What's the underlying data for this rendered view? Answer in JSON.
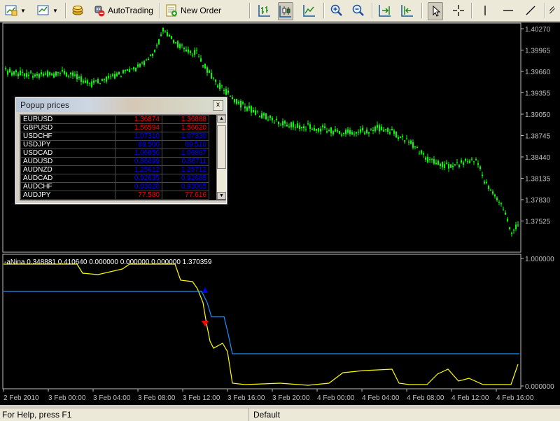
{
  "toolbar": {
    "autotrading_label": "AutoTrading",
    "new_order_label": "New Order"
  },
  "chart": {
    "price_ticks": [
      "1.40270",
      "1.39965",
      "1.39660",
      "1.39355",
      "1.39050",
      "1.38745",
      "1.38440",
      "1.38135",
      "1.37830",
      "1.37525"
    ],
    "indicator_label": "-aNina 0.348881 0.410640 0.000000 0.000000 0.000000 1.370359",
    "indicator_ticks": [
      "1.000000",
      "0.000000"
    ],
    "time_ticks": [
      "2 Feb 2010",
      "3 Feb 00:00",
      "3 Feb 04:00",
      "3 Feb 08:00",
      "3 Feb 12:00",
      "3 Feb 16:00",
      "3 Feb 20:00",
      "4 Feb 00:00",
      "4 Feb 04:00",
      "4 Feb 08:00",
      "4 Feb 12:00",
      "4 Feb 16:00"
    ],
    "colors": {
      "candles": "#00ff00",
      "indicator_main": "#ffff00",
      "indicator_signal": "#1e90ff",
      "arrow_up": "#0000ff",
      "arrow_down": "#ff0000",
      "axis": "#c0c0c0"
    }
  },
  "popup": {
    "title": "Popup prices",
    "close_glyph": "x",
    "rows": [
      {
        "symbol": "EURUSD",
        "bid": "1.36874",
        "ask": "1.36888",
        "color": "#ff0000"
      },
      {
        "symbol": "GBPUSD",
        "bid": "1.56594",
        "ask": "1.56620",
        "color": "#ff0000"
      },
      {
        "symbol": "USDCHF",
        "bid": "1.07310",
        "ask": "1.07330",
        "color": "#0000ff"
      },
      {
        "symbol": "USDJPY",
        "bid": "89.500",
        "ask": "89.510",
        "color": "#0000ff"
      },
      {
        "symbol": "USDCAD",
        "bid": "1.06856",
        "ask": "1.06887",
        "color": "#0000ff"
      },
      {
        "symbol": "AUDUSD",
        "bid": "0.86699",
        "ask": "0.86711",
        "color": "#0000ff"
      },
      {
        "symbol": "AUDNZD",
        "bid": "1.25612",
        "ask": "1.25712",
        "color": "#0000ff"
      },
      {
        "symbol": "AUDCAD",
        "bid": "0.92635",
        "ask": "0.92685",
        "color": "#0000ff"
      },
      {
        "symbol": "AUDCHF",
        "bid": "0.93028",
        "ask": "0.93065",
        "color": "#0000ff"
      },
      {
        "symbol": "AUDJPY",
        "bid": "77.580",
        "ask": "77.616",
        "color": "#ff0000"
      }
    ]
  },
  "status": {
    "help_text": "For Help, press F1",
    "profile": "Default"
  }
}
